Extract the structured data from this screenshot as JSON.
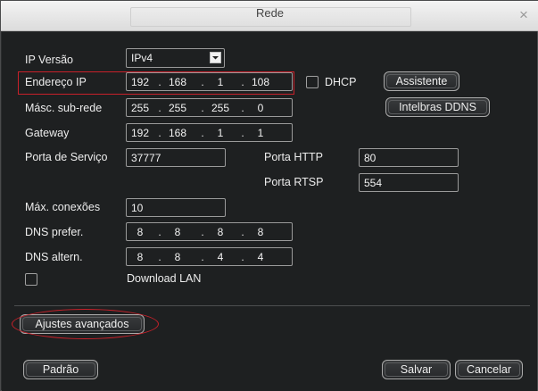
{
  "window": {
    "title": "Rede",
    "close_glyph": "×"
  },
  "ip_version": {
    "label": "IP  Versão",
    "value": "IPv4"
  },
  "ip_address": {
    "label": "Endereço IP",
    "segments": [
      "192",
      "168",
      "1",
      "108"
    ]
  },
  "dhcp": {
    "label": "DHCP",
    "checked": false
  },
  "assistant_button": "Assistente",
  "subnet_mask": {
    "label": "Másc. sub-rede",
    "segments": [
      "255",
      "255",
      "255",
      "0"
    ]
  },
  "ddns_button": "Intelbras DDNS",
  "gateway": {
    "label": "Gateway",
    "segments": [
      "192",
      "168",
      "1",
      "1"
    ]
  },
  "service_port": {
    "label": "Porta de Serviço",
    "value": "37777"
  },
  "http_port": {
    "label": "Porta HTTP",
    "value": "80"
  },
  "rtsp_port": {
    "label": "Porta RTSP",
    "value": "554"
  },
  "max_connections": {
    "label": "Máx. conexões",
    "value": "10"
  },
  "dns_preferred": {
    "label": "DNS prefer.",
    "segments": [
      "8",
      "8",
      "8",
      "8"
    ]
  },
  "dns_alternate": {
    "label": "DNS altern.",
    "segments": [
      "8",
      "8",
      "4",
      "4"
    ]
  },
  "download_lan": {
    "label": "Download LAN",
    "checked": false
  },
  "advanced_button": "Ajustes avançados",
  "footer": {
    "default_button": "Padrão",
    "save_button": "Salvar",
    "cancel_button": "Cancelar"
  },
  "colors": {
    "highlight": "#c8202a",
    "background": "#1e2021",
    "text": "#ededed"
  }
}
